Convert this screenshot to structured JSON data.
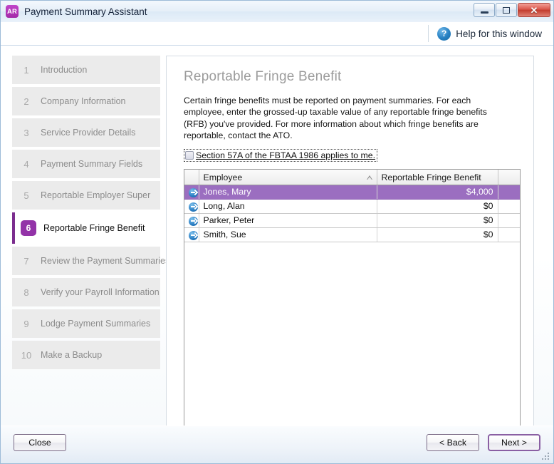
{
  "window": {
    "app_icon_label": "AR",
    "title": "Payment Summary Assistant",
    "minimize_title": "Minimize",
    "maximize_title": "Maximize",
    "close_title": "Close"
  },
  "helpbar": {
    "icon_glyph": "?",
    "label": "Help for this window"
  },
  "sidebar": {
    "steps": [
      {
        "num": "1",
        "label": "Introduction"
      },
      {
        "num": "2",
        "label": "Company Information"
      },
      {
        "num": "3",
        "label": "Service Provider Details"
      },
      {
        "num": "4",
        "label": "Payment Summary Fields"
      },
      {
        "num": "5",
        "label": "Reportable Employer Super"
      },
      {
        "num": "6",
        "label": "Reportable Fringe Benefit"
      },
      {
        "num": "7",
        "label": "Review the Payment Summaries"
      },
      {
        "num": "8",
        "label": "Verify your Payroll Information"
      },
      {
        "num": "9",
        "label": "Lodge Payment Summaries"
      },
      {
        "num": "10",
        "label": "Make a Backup"
      }
    ],
    "active_index": 5
  },
  "content": {
    "title": "Reportable Fringe Benefit",
    "description": "Certain fringe benefits must be reported on payment summaries. For each employee, enter the grossed-up taxable value of any reportable fringe benefits (RFB) you've provided. For more information about which fringe benefits are reportable, contact the ATO.",
    "checkbox": {
      "label": "Section 57A of the FBTAA 1986 applies to me.",
      "checked": false
    },
    "table": {
      "columns": [
        "",
        "Employee",
        "Reportable Fringe Benefit",
        ""
      ],
      "sort_column": "Employee",
      "sort_direction": "ascending",
      "rows": [
        {
          "employee": "Jones, Mary",
          "rfb": "$4,000",
          "selected": true
        },
        {
          "employee": "Long, Alan",
          "rfb": "$0",
          "selected": false
        },
        {
          "employee": "Parker, Peter",
          "rfb": "$0",
          "selected": false
        },
        {
          "employee": "Smith, Sue",
          "rfb": "$0",
          "selected": false
        }
      ]
    }
  },
  "footer": {
    "close_label": "Close",
    "back_label": "< Back",
    "next_label": "Next >"
  },
  "colors": {
    "accent_purple": "#9333a8",
    "active_bar": "#7b2d8e",
    "selection_row": "#9b6ec0",
    "help_blue": "#2680c2",
    "frame_blue": "#9dbbd8"
  }
}
